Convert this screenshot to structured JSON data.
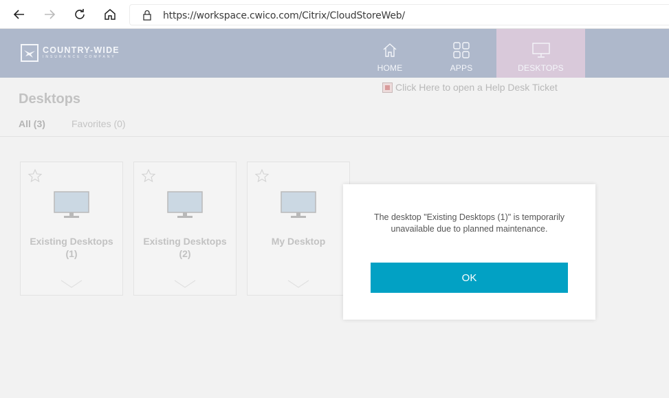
{
  "browser": {
    "url": "https://workspace.cwico.com/Citrix/CloudStoreWeb/",
    "back_icon": "back-arrow-icon",
    "forward_icon": "forward-arrow-icon",
    "refresh_icon": "refresh-icon",
    "home_icon": "home-icon",
    "lock_icon": "lock-icon"
  },
  "header": {
    "logo_line1": "COUNTRY-WIDE",
    "logo_line2": "INSURANCE COMPANY",
    "background_color": "#aeb8cb",
    "tabs": [
      {
        "label": "HOME",
        "icon": "home-icon",
        "active": false
      },
      {
        "label": "APPS",
        "icon": "apps-grid-icon",
        "active": false
      },
      {
        "label": "DESKTOPS",
        "icon": "monitor-icon",
        "active": true
      }
    ],
    "active_tab_color": "#d9c9da"
  },
  "content": {
    "helpdesk_link": "Click Here to open a Help Desk Ticket",
    "title": "Desktops",
    "filters": [
      {
        "label": "All (3)",
        "active": true
      },
      {
        "label": "Favorites (0)",
        "active": false
      }
    ],
    "tiles": [
      {
        "name": "Existing Desktops (1)"
      },
      {
        "name": "Existing Desktops (2)"
      },
      {
        "name": "My Desktop"
      }
    ]
  },
  "modal": {
    "message": "The desktop \"Existing Desktops (1)\" is temporarily unavailable due to planned maintenance.",
    "ok_label": "OK",
    "button_color": "#02a1c4"
  }
}
